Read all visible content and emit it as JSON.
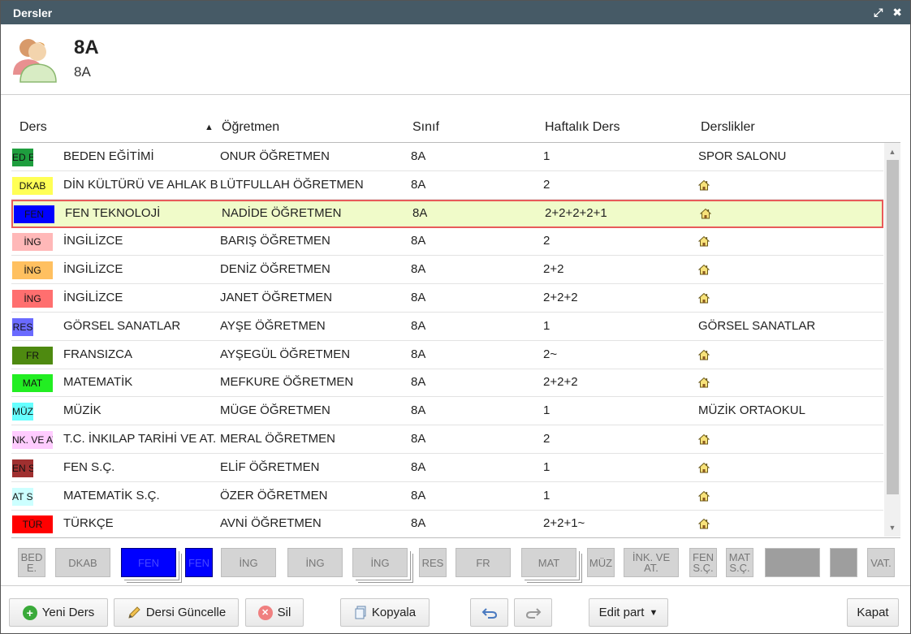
{
  "window": {
    "title": "Dersler"
  },
  "header": {
    "title": "8A",
    "subtitle": "8A"
  },
  "grid": {
    "columns": {
      "ders": "Ders",
      "ogretmen": "Öğretmen",
      "sinif": "Sınıf",
      "haftalik": "Haftalık Ders",
      "derslikler": "Derslikler"
    },
    "rows": [
      {
        "code": "ED E",
        "color": "#1e9e3e",
        "name": "BEDEN EĞİTİMİ",
        "teacher": "ONUR ÖĞRETMEN",
        "class": "8A",
        "weekly": "1",
        "room": "SPOR SALONU"
      },
      {
        "code": "DKAB",
        "color": "#ffff55",
        "name": "DİN KÜLTÜRÜ VE AHLAK B",
        "teacher": "LÜTFULLAH ÖĞRETMEN",
        "class": "8A",
        "weekly": "2",
        "room": ""
      },
      {
        "code": "FEN",
        "color": "#0000ff",
        "name": "FEN TEKNOLOJİ",
        "teacher": "NADİDE ÖĞRETMEN",
        "class": "8A",
        "weekly": "2+2+2+2+1",
        "room": ""
      },
      {
        "code": "İNG",
        "color": "#ffb8b8",
        "name": "İNGİLİZCE",
        "teacher": "BARIŞ ÖĞRETMEN",
        "class": "8A",
        "weekly": "2",
        "room": ""
      },
      {
        "code": "İNG",
        "color": "#ffc060",
        "name": "İNGİLİZCE",
        "teacher": "DENİZ ÖĞRETMEN",
        "class": "8A",
        "weekly": "2+2",
        "room": ""
      },
      {
        "code": "İNG",
        "color": "#ff6f6f",
        "name": "İNGİLİZCE",
        "teacher": "JANET ÖĞRETMEN",
        "class": "8A",
        "weekly": "2+2+2",
        "room": ""
      },
      {
        "code": "RES",
        "color": "#6a6aff",
        "name": "GÖRSEL SANATLAR",
        "teacher": "AYŞE ÖĞRETMEN",
        "class": "8A",
        "weekly": "1",
        "room": "GÖRSEL SANATLAR"
      },
      {
        "code": "FR",
        "color": "#4e8a10",
        "name": "FRANSIZCA",
        "teacher": "AYŞEGÜL ÖĞRETMEN",
        "class": "8A",
        "weekly": "2~",
        "room": ""
      },
      {
        "code": "MAT",
        "color": "#22ee22",
        "name": "MATEMATİK",
        "teacher": "MEFKURE ÖĞRETMEN",
        "class": "8A",
        "weekly": "2+2+2",
        "room": ""
      },
      {
        "code": "MÜZ",
        "color": "#66ffff",
        "name": "MÜZİK",
        "teacher": "MÜGE ÖĞRETMEN",
        "class": "8A",
        "weekly": "1",
        "room": "MÜZİK ORTAOKUL"
      },
      {
        "code": "NK. VE AT",
        "color": "#ffccff",
        "name": "T.C. İNKILAP TARİHİ VE AT.",
        "teacher": "MERAL ÖĞRETMEN",
        "class": "8A",
        "weekly": "2",
        "room": ""
      },
      {
        "code": "EN S.",
        "color": "#a03030",
        "name": "FEN S.Ç.",
        "teacher": "ELİF ÖĞRETMEN",
        "class": "8A",
        "weekly": "1",
        "room": ""
      },
      {
        "code": "AT S.",
        "color": "#ccffff",
        "name": "MATEMATİK S.Ç.",
        "teacher": "ÖZER ÖĞRETMEN",
        "class": "8A",
        "weekly": "1",
        "room": ""
      },
      {
        "code": "TÜR",
        "color": "#ff0000",
        "name": "TÜRKÇE",
        "teacher": "AVNİ ÖĞRETMEN",
        "class": "8A",
        "weekly": "2+2+1~",
        "room": ""
      }
    ]
  },
  "tiles": [
    "BED E.",
    "DKAB",
    "FEN",
    "FEN",
    "İNG",
    "İNG",
    "İNG",
    "RES",
    "FR",
    "MAT",
    "MÜZ",
    "İNK. VE AT.",
    "FEN S.Ç.",
    "MAT S.Ç.",
    "",
    "",
    "VAT."
  ],
  "footer": {
    "new_label": "Yeni Ders",
    "update_label": "Dersi Güncelle",
    "delete_label": "Sil",
    "copy_label": "Kopyala",
    "edit_part_label": "Edit part",
    "close_label": "Kapat"
  }
}
